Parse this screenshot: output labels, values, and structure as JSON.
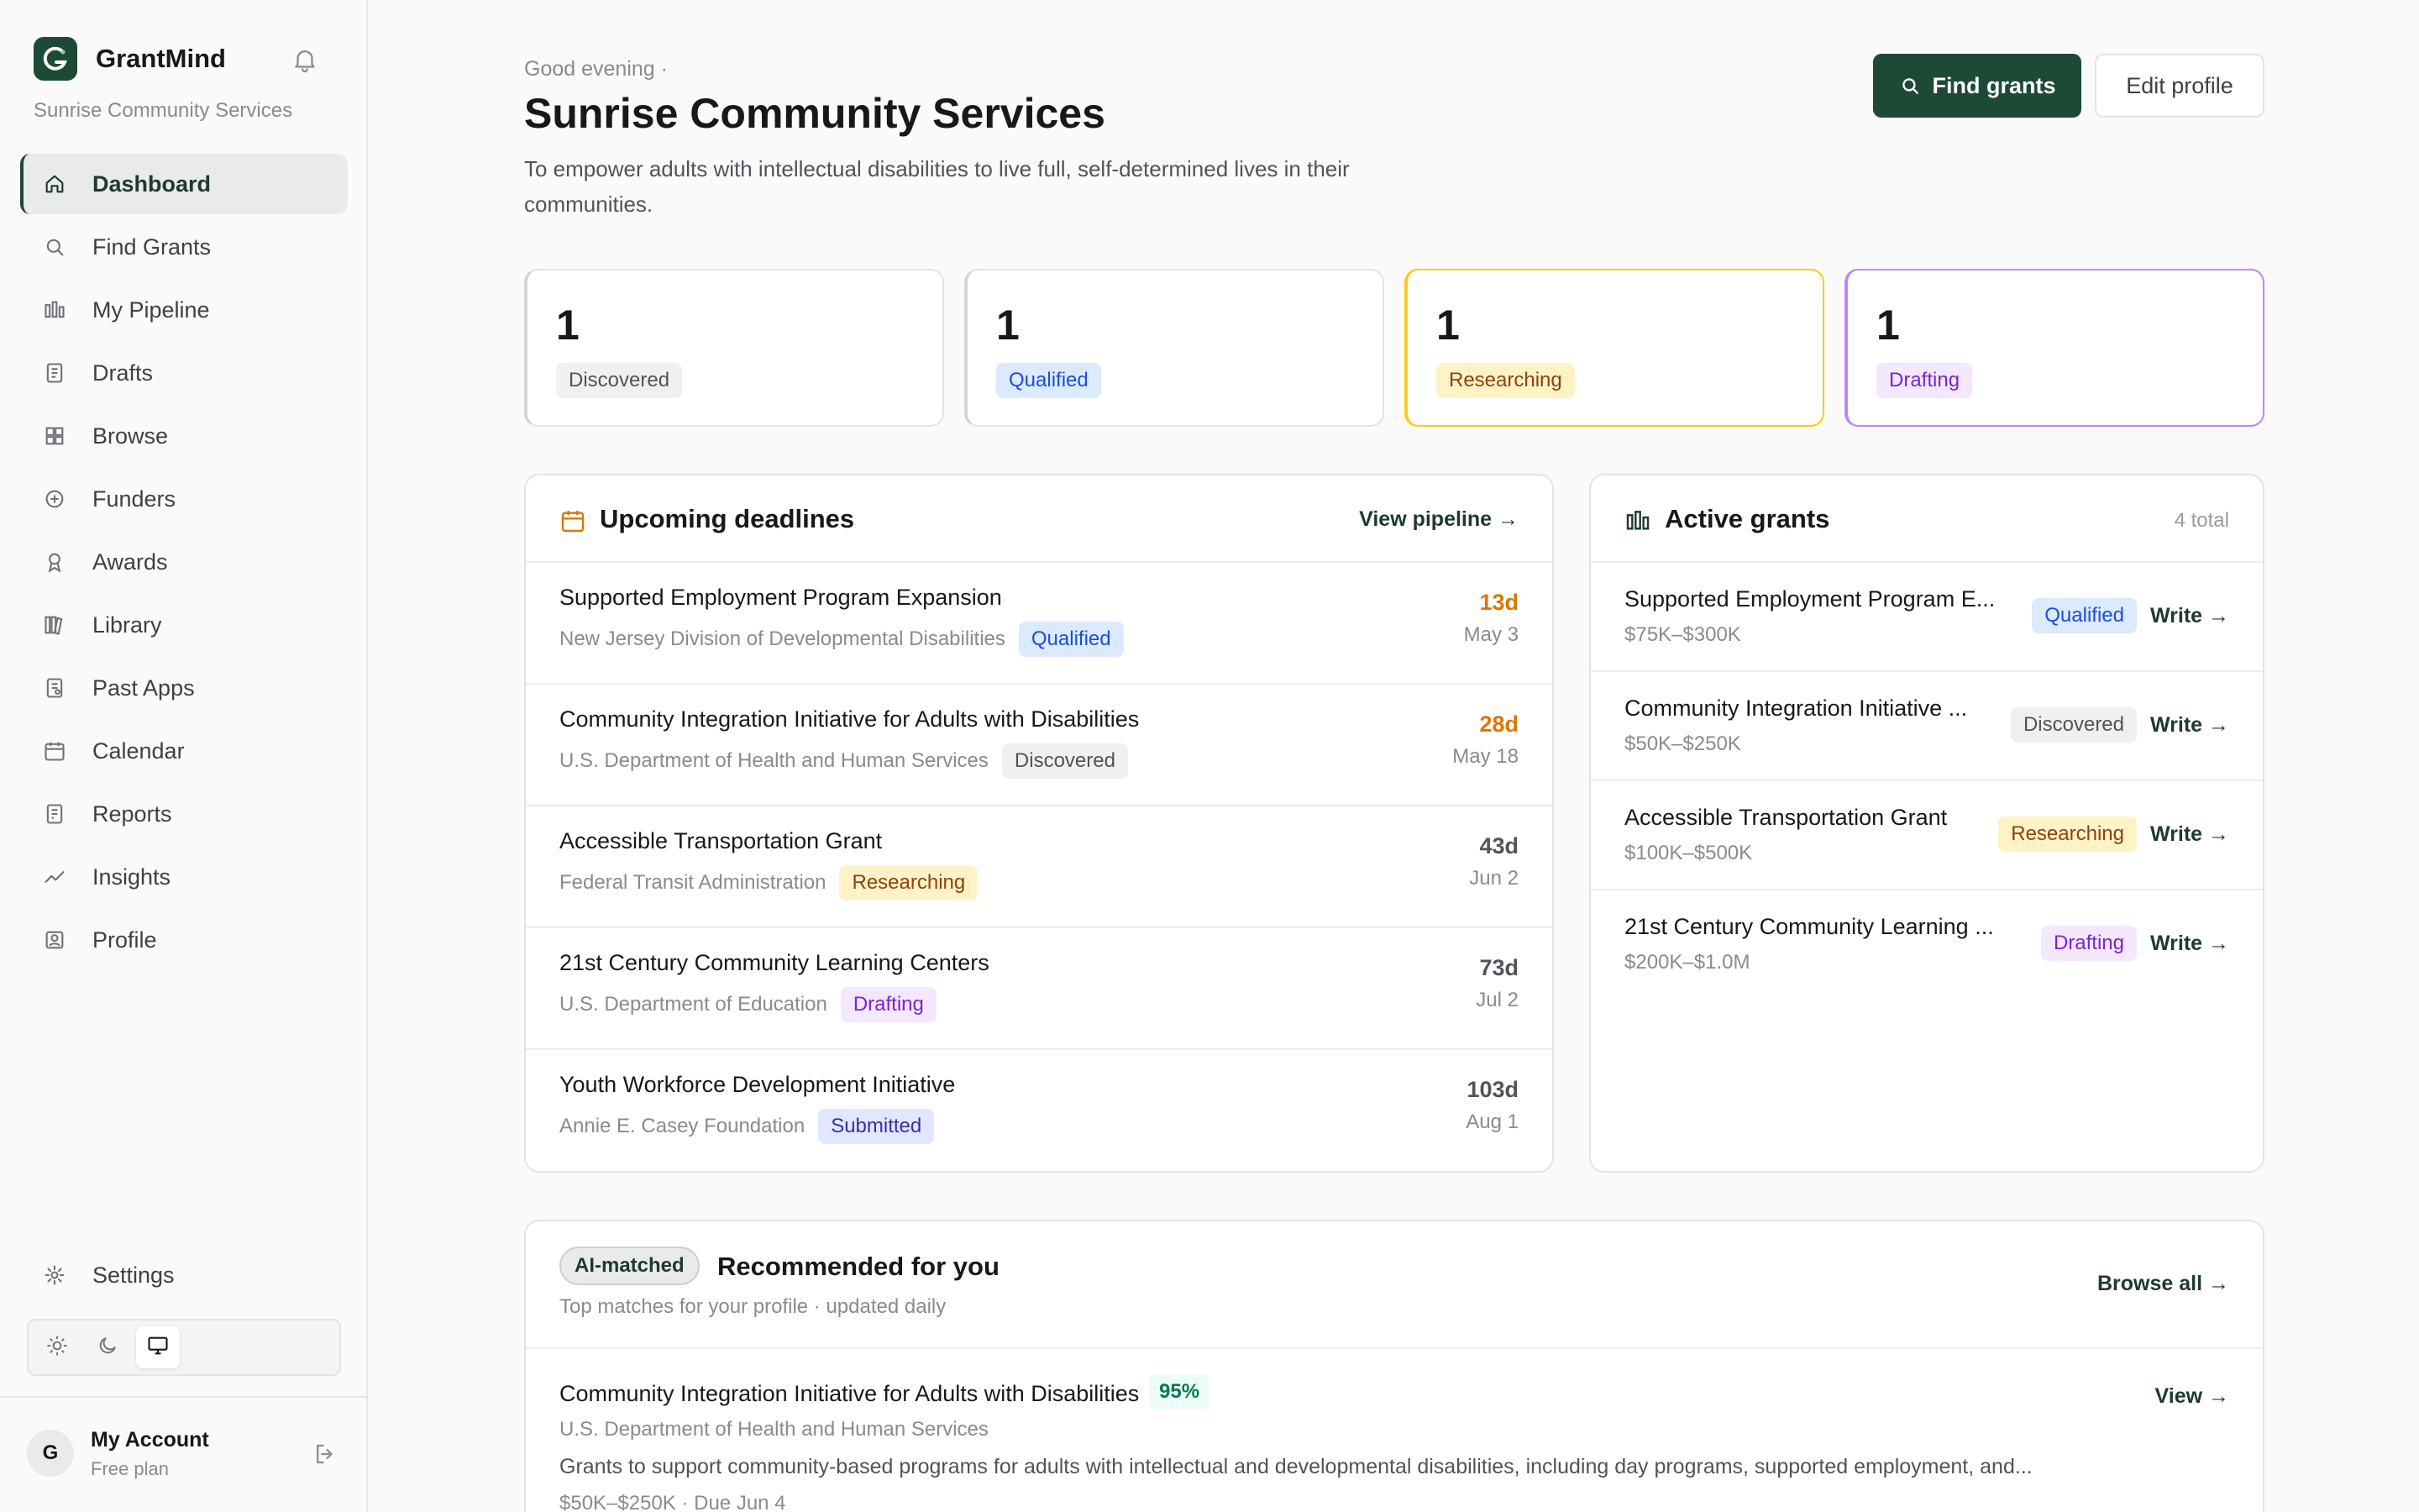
{
  "sidebar": {
    "brand": "GrantMind",
    "org": "Sunrise Community Services",
    "nav": [
      {
        "label": "Dashboard",
        "icon": "home-icon"
      },
      {
        "label": "Find Grants",
        "icon": "search-icon"
      },
      {
        "label": "My Pipeline",
        "icon": "pipeline-icon"
      },
      {
        "label": "Drafts",
        "icon": "document-icon"
      },
      {
        "label": "Browse",
        "icon": "grid-icon"
      },
      {
        "label": "Funders",
        "icon": "circle-plus-icon"
      },
      {
        "label": "Awards",
        "icon": "award-icon"
      },
      {
        "label": "Library",
        "icon": "library-icon"
      },
      {
        "label": "Past Apps",
        "icon": "file-list-icon"
      },
      {
        "label": "Calendar",
        "icon": "calendar-icon"
      },
      {
        "label": "Reports",
        "icon": "report-icon"
      },
      {
        "label": "Insights",
        "icon": "trend-icon"
      },
      {
        "label": "Profile",
        "icon": "profile-icon"
      }
    ],
    "settings": "Settings",
    "account": {
      "name": "My Account",
      "plan": "Free plan",
      "initial": "G"
    }
  },
  "header": {
    "greeting": "Good evening ·",
    "title": "Sunrise Community Services",
    "mission": "To empower adults with intellectual disabilities to live full, self-determined lives in their communities.",
    "find_button": "Find grants",
    "edit_button": "Edit profile"
  },
  "stats": [
    {
      "count": "1",
      "label": "Discovered",
      "color": "#d4d4d8"
    },
    {
      "count": "1",
      "label": "Qualified",
      "color": "#d4d4d8"
    },
    {
      "count": "1",
      "label": "Researching",
      "color": "#facc15"
    },
    {
      "count": "1",
      "label": "Drafting",
      "color": "#c084fc"
    }
  ],
  "deadlines": {
    "title": "Upcoming deadlines",
    "link": "View pipeline →",
    "rows": [
      {
        "name": "Supported Employment Program Expansion",
        "funder": "New Jersey Division of Developmental Disabilities",
        "status": "Qualified",
        "days": "13d",
        "date": "May 3",
        "days_color": "#d97706"
      },
      {
        "name": "Community Integration Initiative for Adults with Disabilities",
        "funder": "U.S. Department of Health and Human Services",
        "status": "Discovered",
        "days": "28d",
        "date": "May 18",
        "days_color": "#d97706"
      },
      {
        "name": "Accessible Transportation Grant",
        "funder": "Federal Transit Administration",
        "status": "Researching",
        "days": "43d",
        "date": "Jun 2",
        "days_color": "#52525b"
      },
      {
        "name": "21st Century Community Learning Centers",
        "funder": "U.S. Department of Education",
        "status": "Drafting",
        "days": "73d",
        "date": "Jul 2",
        "days_color": "#52525b"
      },
      {
        "name": "Youth Workforce Development Initiative",
        "funder": "Annie E. Casey Foundation",
        "status": "Submitted",
        "days": "103d",
        "date": "Aug 1",
        "days_color": "#52525b"
      }
    ]
  },
  "active": {
    "title": "Active grants",
    "count": "4 total",
    "write_label": "Write →",
    "rows": [
      {
        "name": "Supported Employment Program E...",
        "amount": "$75K–$300K",
        "status": "Qualified"
      },
      {
        "name": "Community Integration Initiative ...",
        "amount": "$50K–$250K",
        "status": "Discovered"
      },
      {
        "name": "Accessible Transportation Grant",
        "amount": "$100K–$500K",
        "status": "Researching"
      },
      {
        "name": "21st Century Community Learning ...",
        "amount": "$200K–$1.0M",
        "status": "Drafting"
      }
    ]
  },
  "recommended": {
    "badge": "AI-matched",
    "title": "Recommended for you",
    "subtitle": "Top matches for your profile · updated daily",
    "link": "Browse all →",
    "item": {
      "name": "Community Integration Initiative for Adults with Disabilities",
      "match": "95%",
      "funder": "U.S. Department of Health and Human Services",
      "description": "Grants to support community-based programs for adults with intellectual and developmental disabilities, including day programs, supported employment, and...",
      "footer": "$50K–$250K · Due Jun 4",
      "view": "View →"
    }
  }
}
